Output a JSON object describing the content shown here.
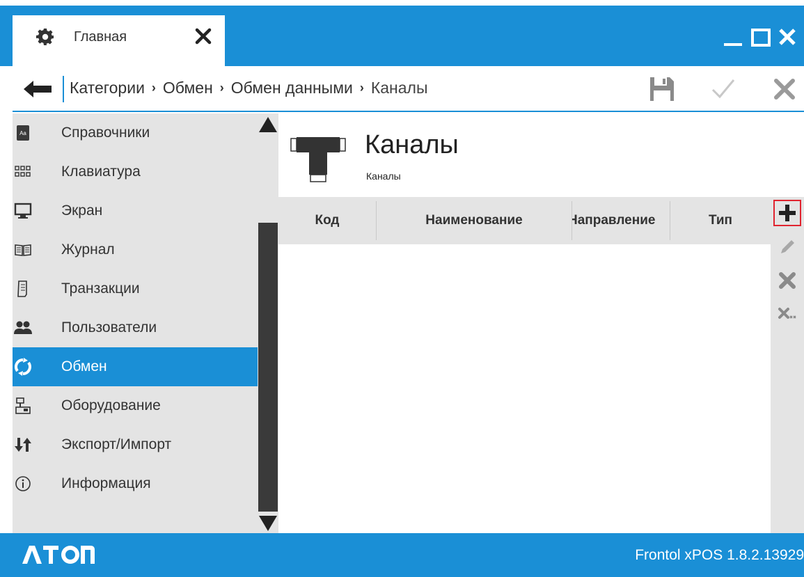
{
  "window": {
    "tab_label": "Главная",
    "tab_icon": "gear-icon",
    "controls": [
      "minimize",
      "maximize",
      "close"
    ]
  },
  "breadcrumb": {
    "items": [
      "Категории",
      "Обмен",
      "Обмен данными",
      "Каналы"
    ],
    "actions": [
      "save",
      "apply",
      "cancel"
    ]
  },
  "sidebar": {
    "items": [
      {
        "label": "Справочники",
        "icon": "book-icon",
        "active": false
      },
      {
        "label": "Клавиатура",
        "icon": "keyboard-icon",
        "active": false
      },
      {
        "label": "Экран",
        "icon": "monitor-icon",
        "active": false
      },
      {
        "label": "Журнал",
        "icon": "journal-icon",
        "active": false
      },
      {
        "label": "Транзакции",
        "icon": "receipt-icon",
        "active": false
      },
      {
        "label": "Пользователи",
        "icon": "users-icon",
        "active": false
      },
      {
        "label": "Обмен",
        "icon": "sync-icon",
        "active": true
      },
      {
        "label": "Оборудование",
        "icon": "equipment-icon",
        "active": false
      },
      {
        "label": "Экспорт/Импорт",
        "icon": "export-import-icon",
        "active": false
      },
      {
        "label": "Информация",
        "icon": "info-icon",
        "active": false
      }
    ]
  },
  "page": {
    "title": "Каналы",
    "subtitle": "Каналы",
    "icon": "pipe-icon"
  },
  "grid": {
    "columns": [
      "Код",
      "Наименование",
      "Направление",
      "Тип"
    ],
    "rows": []
  },
  "row_actions": [
    "add",
    "edit",
    "delete",
    "delete-all"
  ],
  "footer": {
    "brand": "ATOL",
    "version": "Frontol xPOS 1.8.2.13929"
  },
  "colors": {
    "accent": "#1a8fd6",
    "sidebar_bg": "#e4e4e4",
    "highlight": "#e0242f"
  }
}
